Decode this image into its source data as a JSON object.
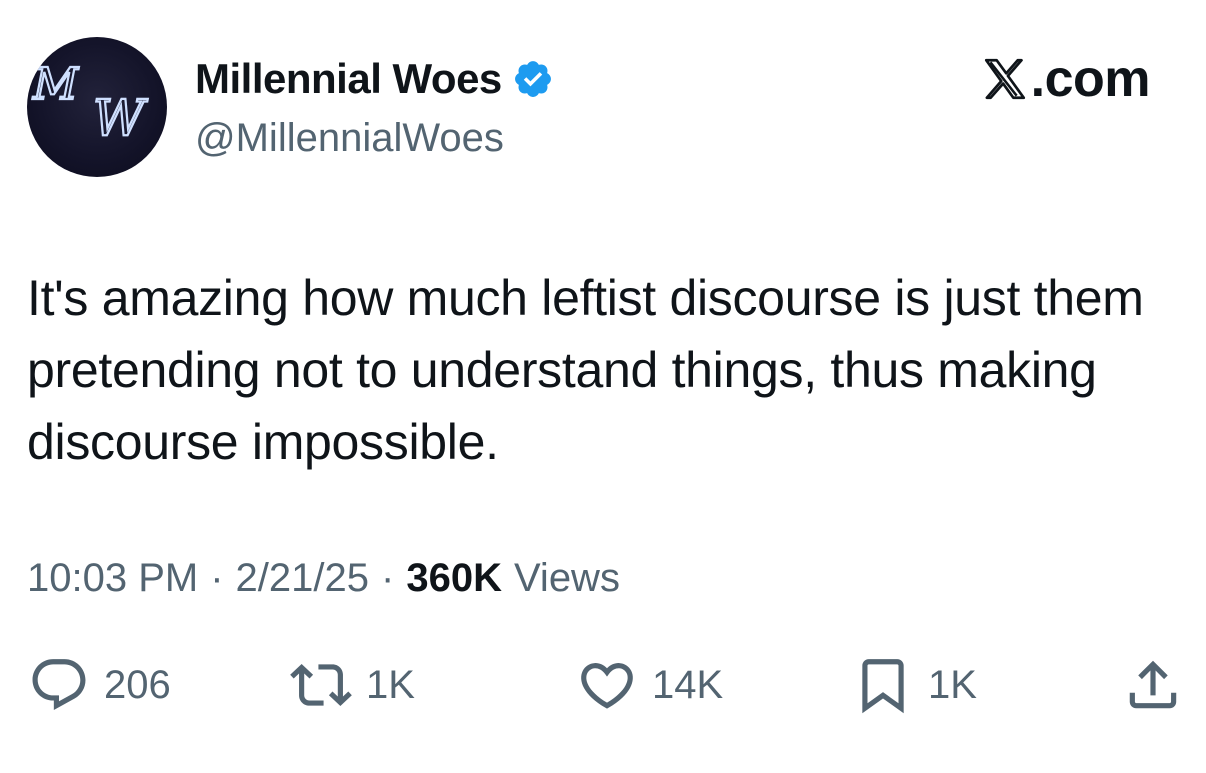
{
  "author": {
    "display_name": "Millennial Woes",
    "handle": "@MillennialWoes",
    "avatar_monogram": "MW",
    "verified_icon": "verified-badge-icon"
  },
  "brand": {
    "logo_icon": "x-logo-icon",
    "text": ".com"
  },
  "tweet": {
    "text": "It's amazing how much leftist discourse is just them pretending not to understand things, thus making discourse impossible."
  },
  "meta": {
    "time": "10:03 PM",
    "separator": "·",
    "date": "2/21/25",
    "views_count": "360K",
    "views_label": "Views"
  },
  "actions": {
    "reply": {
      "icon": "reply-icon",
      "count": "206"
    },
    "repost": {
      "icon": "repost-icon",
      "count": "1K"
    },
    "like": {
      "icon": "heart-icon",
      "count": "14K"
    },
    "bookmark": {
      "icon": "bookmark-icon",
      "count": "1K"
    },
    "share": {
      "icon": "share-icon"
    }
  },
  "colors": {
    "text_primary": "#0f1419",
    "text_secondary": "#536471",
    "verified_blue": "#1d9bf0",
    "background": "#ffffff"
  }
}
